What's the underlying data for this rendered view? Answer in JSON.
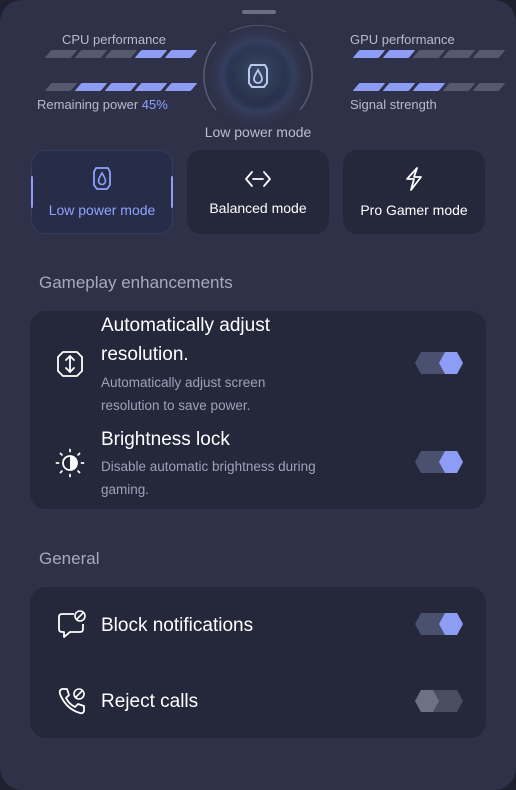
{
  "stats": {
    "cpu_label": "CPU performance",
    "gpu_label": "GPU performance",
    "remaining_label": "Remaining power",
    "remaining_value": "45%",
    "signal_label": "Signal strength",
    "cpu_level": 2,
    "remaining_level": 4,
    "gpu_level": 2,
    "signal_level": 3,
    "segments": 5
  },
  "current_mode": "Low power mode",
  "modes": [
    {
      "label": "Low power mode",
      "icon": "shield-drop-icon",
      "active": true
    },
    {
      "label": "Balanced mode",
      "icon": "balance-arrows-icon",
      "active": false
    },
    {
      "label": "Pro Gamer mode",
      "icon": "lightning-icon",
      "active": false
    }
  ],
  "gameplay": {
    "title": "Gameplay enhancements",
    "items": [
      {
        "title": "Automatically adjust resolution.",
        "subtitle": "Automatically adjust screen resolution to save power.",
        "icon": "resolution-icon",
        "enabled": true
      },
      {
        "title": "Brightness lock",
        "subtitle": "Disable automatic brightness during gaming.",
        "icon": "brightness-icon",
        "enabled": true
      }
    ]
  },
  "general": {
    "title": "General",
    "items": [
      {
        "title": "Block notifications",
        "icon": "block-notifications-icon",
        "enabled": true
      },
      {
        "title": "Reject calls",
        "icon": "reject-calls-icon",
        "enabled": false
      }
    ]
  },
  "colors": {
    "accent": "#8d9cf5",
    "panel": "#2e3147",
    "card": "#25283b"
  }
}
